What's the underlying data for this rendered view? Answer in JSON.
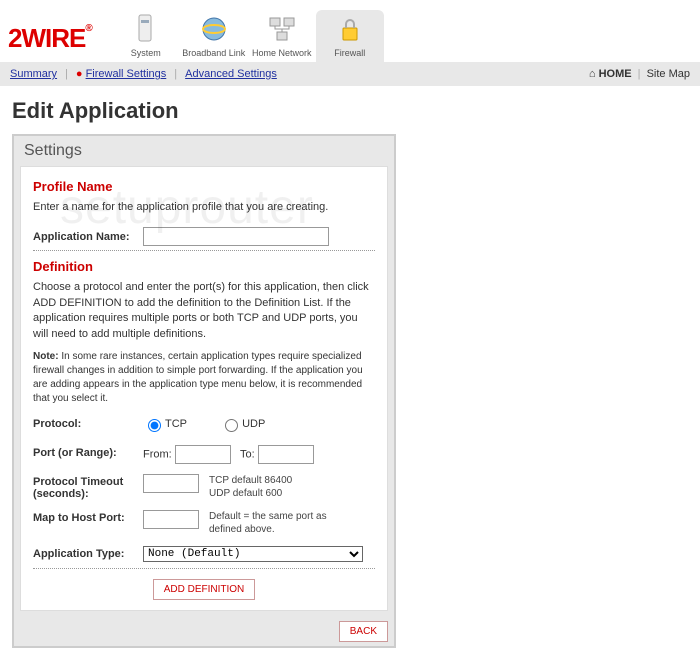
{
  "brand": "2WIRE",
  "tabs": [
    {
      "label": "System"
    },
    {
      "label": "Broadband Link"
    },
    {
      "label": "Home Network"
    },
    {
      "label": "Firewall",
      "active": true
    }
  ],
  "subnav": {
    "summary": "Summary",
    "firewall": "Firewall Settings",
    "advanced": "Advanced Settings",
    "home": "HOME",
    "sitemap": "Site Map"
  },
  "title": "Edit Application",
  "panel_title": "Settings",
  "profile": {
    "heading": "Profile Name",
    "desc": "Enter a name for the application profile that you are creating.",
    "label": "Application Name:",
    "value": ""
  },
  "definition": {
    "heading": "Definition",
    "desc": "Choose a protocol and enter the port(s) for this application, then click ADD DEFINITION to add the definition to the Definition List. If the application requires multiple ports or both TCP and UDP ports, you will need to add multiple definitions.",
    "note_label": "Note:",
    "note": "In some rare instances, certain application types require specialized firewall changes in addition to simple port forwarding. If the application you are adding appears in the application type menu below, it is recommended that you select it.",
    "protocol_label": "Protocol:",
    "tcp": "TCP",
    "udp": "UDP",
    "port_label": "Port (or Range):",
    "from": "From:",
    "to": "To:",
    "timeout_label": "Protocol Timeout (seconds):",
    "timeout_hint": "TCP default 86400\nUDP default 600",
    "map_label": "Map to Host Port:",
    "map_hint": "Default = the same port as defined above.",
    "apptype_label": "Application Type:",
    "apptype_value": "None (Default)",
    "add_btn": "ADD DEFINITION"
  },
  "back": "BACK",
  "watermark": "setuprouter"
}
